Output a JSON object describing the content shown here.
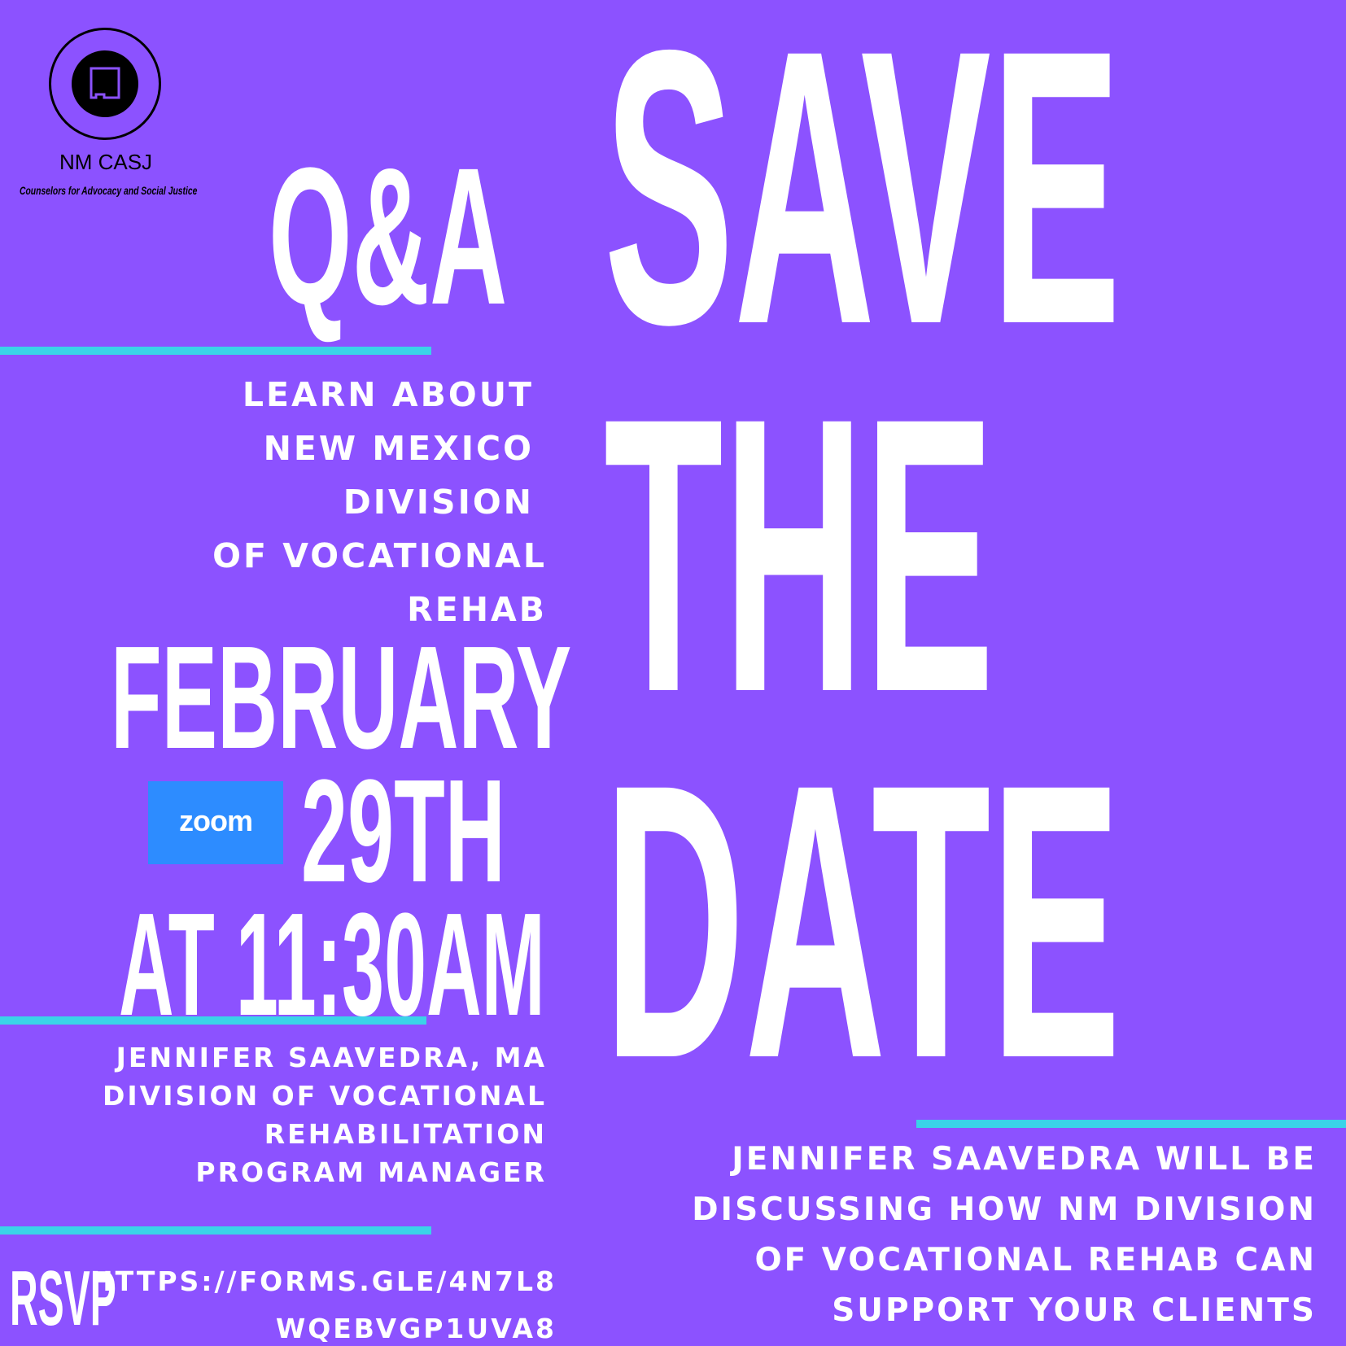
{
  "logo": {
    "name": "NM CASJ",
    "tagline": "Counselors for Advocacy and Social Justice"
  },
  "headline": {
    "qa": "Q&A",
    "save": "SAVE",
    "the": "THE",
    "date": "DATE"
  },
  "learn_about": [
    "LEARN ABOUT",
    "NEW MEXICO",
    "DIVISION",
    "OF VOCATIONAL",
    "REHAB"
  ],
  "when": {
    "month": "FEBRUARY",
    "day": "29TH",
    "time": "AT 11:30AM"
  },
  "platform": {
    "label": "zoom"
  },
  "speaker": [
    "JENNIFER SAAVEDRA, MA",
    "DIVISION OF VOCATIONAL",
    "REHABILITATION",
    "PROGRAM MANAGER"
  ],
  "rsvp": {
    "label": "RSVP",
    "url_lines": [
      "HTTPS://FORMS.GLE/4N7L8",
      "WQEBVGP1UVA8"
    ]
  },
  "description": [
    "JENNIFER SAAVEDRA WILL BE",
    "DISCUSSING HOW NM DIVISION",
    "OF VOCATIONAL REHAB CAN",
    "SUPPORT YOUR CLIENTS"
  ],
  "colors": {
    "background": "#8c52ff",
    "accent_rule": "#3ad3e8",
    "zoom_blue": "#2d8cff",
    "text": "#ffffff"
  }
}
